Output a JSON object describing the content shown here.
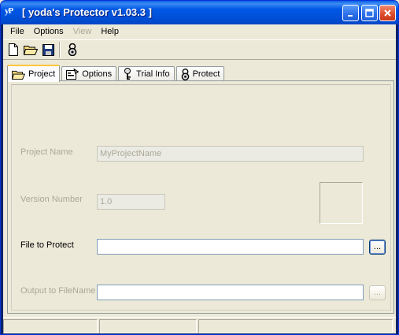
{
  "window": {
    "title": "[ yoda's Protector v1.03.3 ]",
    "app_icon": "yP",
    "minimize": "minimize-icon",
    "maximize": "maximize-icon",
    "close": "close-icon"
  },
  "menu": {
    "items": [
      {
        "label": "File",
        "enabled": true
      },
      {
        "label": "Options",
        "enabled": true
      },
      {
        "label": "View",
        "enabled": false
      },
      {
        "label": "Help",
        "enabled": true
      }
    ]
  },
  "toolbar": {
    "buttons": [
      "new-file-icon",
      "open-folder-icon",
      "save-disk-icon",
      "protect-icon"
    ]
  },
  "tabs": [
    {
      "label": "Project",
      "icon": "open-folder-icon",
      "active": true
    },
    {
      "label": "Options",
      "icon": "options-icon",
      "active": false
    },
    {
      "label": "Trial Info",
      "icon": "key-icon",
      "active": false
    },
    {
      "label": "Protect",
      "icon": "protect-icon",
      "active": false
    }
  ],
  "project": {
    "project_name_label": "Project Name",
    "project_name_value": "MyProjectName",
    "version_label": "Version Number",
    "version_value": "1.0",
    "file_label": "File to Protect",
    "file_value": "",
    "output_label": "Output to FileName",
    "output_value": "",
    "browse_label": "...",
    "output_browse_label": "..."
  },
  "colors": {
    "titlebar": "#0058e6",
    "face": "#ece9d8",
    "disabled_text": "#aca899",
    "active_tab_accent": "#ffc83c"
  }
}
